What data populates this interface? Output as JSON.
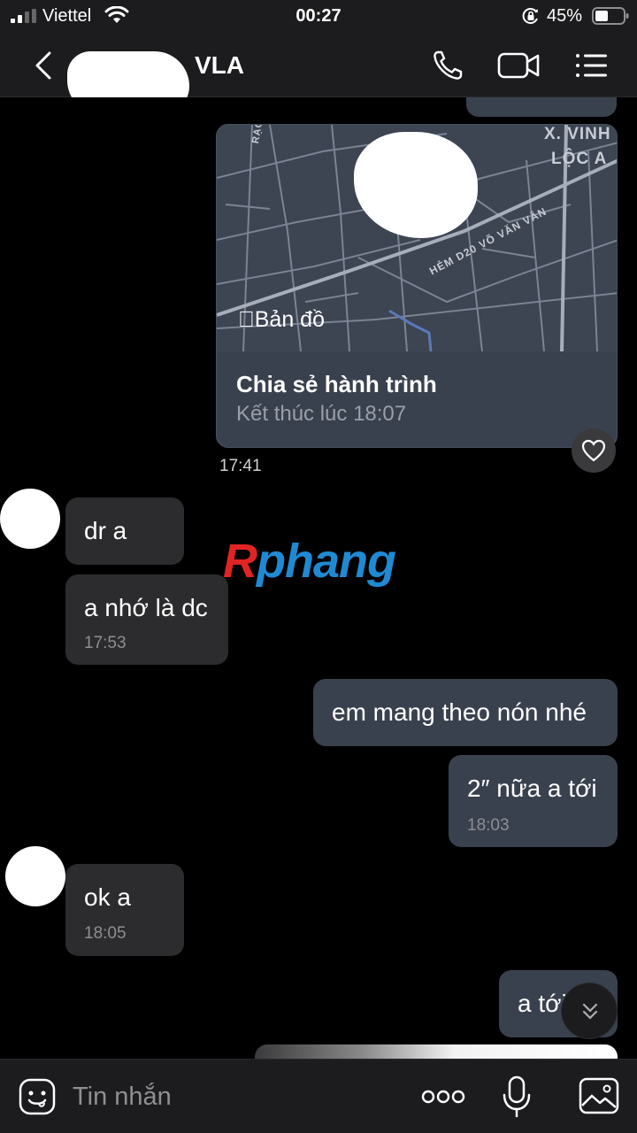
{
  "status_bar": {
    "carrier": "Viettel",
    "time": "00:27",
    "battery_percent": "45%",
    "icons": [
      "signal-icon",
      "wifi-icon",
      "orientation-lock-icon",
      "battery-icon"
    ]
  },
  "header": {
    "contact_name_suffix": "VLA",
    "icons": [
      "back-icon",
      "phone-icon",
      "video-call-icon",
      "menu-icon"
    ]
  },
  "location_card": {
    "maps_brand": "Bản đồ",
    "title": "Chia sẻ hành trình",
    "subtitle": "Kết thúc lúc 18:07",
    "time": "17:41",
    "map_labels": {
      "district_line1": "X. VINH",
      "district_line2": "LỘC A",
      "street": "HẺM D20 VÕ VĂN VÂN",
      "street_top": "RẠCH"
    }
  },
  "messages": [
    {
      "direction": "in",
      "text": "dr a",
      "time": ""
    },
    {
      "direction": "in",
      "text": "a nhớ là dc",
      "time": "17:53"
    },
    {
      "direction": "out",
      "text": "em mang theo nón nhé",
      "time": ""
    },
    {
      "direction": "out",
      "text": "2″ nữa a tới",
      "time": "18:03"
    },
    {
      "direction": "in",
      "text": "ok a",
      "time": "18:05"
    },
    {
      "direction": "out",
      "text": "a tới",
      "time": ""
    }
  ],
  "watermark": {
    "first": "R",
    "rest": "phang"
  },
  "composer": {
    "placeholder": "Tin nhắn",
    "icons": [
      "sticker-icon",
      "more-icon",
      "microphone-icon",
      "gallery-icon"
    ]
  },
  "colors": {
    "background": "#000000",
    "bar": "#1c1c1e",
    "incoming_bubble": "#2c2c2e",
    "outgoing_bubble": "#3a414e",
    "timestamp": "#8e8e93"
  }
}
